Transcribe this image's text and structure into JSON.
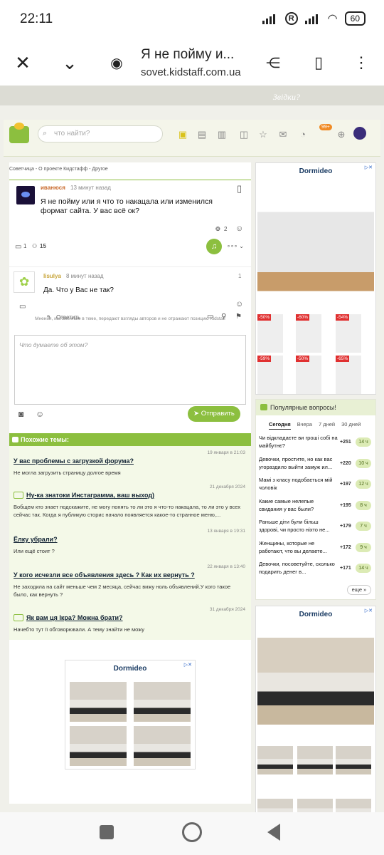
{
  "status": {
    "time": "22:11",
    "battery": "60"
  },
  "browser": {
    "title": "Я не пойму и...",
    "url": "sovet.kidstaff.com.ua"
  },
  "site": {
    "banner_text": "Звідки?",
    "search_placeholder": "что найти?",
    "badge": "99+"
  },
  "breadcrumb": "Советчица - О проекте Кидстафф - Другое",
  "post": {
    "author": "иванюся",
    "time": "13 минут назад",
    "text": "Я не пойму или я что то накацала или изменился формат сайта. У вас всё ок?",
    "reactions": "2",
    "comments": "1",
    "participants": "15"
  },
  "reply": {
    "author": "lisulya",
    "time": "8 минут назад",
    "number": "1",
    "text": "Да. Что у Вас не так?",
    "reply_label": "Ответить"
  },
  "disclaimer": "Мнения, изложенные в теме, передают взгляды авторов и не отражают позицию Kidstaff",
  "composer": {
    "placeholder": "Что думаете об этом?",
    "send_label": "Отправить"
  },
  "similar": {
    "title": "Похожие темы:",
    "topics": [
      {
        "title": "У вас проблемы с загрузкой форума?",
        "date": "19 января в 21:03",
        "text": "Не могла загрузить страницу долгое время",
        "icon": false
      },
      {
        "title": "Ну-ка знатоки Инстаграмма, ваш выход)",
        "date": "21 декабря 2024",
        "text": "Вобщем кто знает подскажите, не могу понять то ли это я что-то накацала, то ли это у всех сейчас так. Когда я публикую сторис начало появляется какое-то странное меню,...",
        "icon": true
      },
      {
        "title": "Ёлку убрали?",
        "date": "13 января в 19:31",
        "text": "Или ещё стоит ?",
        "icon": false
      },
      {
        "title": "У кого исчезли все объявления здесь ? Как их вернуть ?",
        "date": "22 января в 13:40",
        "text": "Не заходила на сайт меньше чем 2 месяца, сейчас вижу ноль объявлений.У кого такое было, как вернуть ?",
        "icon": false
      },
      {
        "title": "Як вам ця Ікра? Можна брати?",
        "date": "31 декабря 2024",
        "text": "Начебто тут її обговорювали. А тему знайти не можу",
        "icon": true
      }
    ]
  },
  "ads": {
    "brand": "Dormideo",
    "discounts": [
      "-50%",
      "-60%",
      "-54%",
      "-59%",
      "-50%",
      "-65%"
    ]
  },
  "popular": {
    "title": "Популярные вопросы!",
    "tabs": [
      "Сегодня",
      "Вчера",
      "7 дней",
      "30 дней"
    ],
    "more": "еще",
    "items": [
      {
        "text": "Чи відкладаєте ви гроші собі на майбутнє?",
        "n": "+251",
        "b": "14 ч"
      },
      {
        "text": "Девочки, простите, но как вас угораздило выйти замуж ил...",
        "n": "+220",
        "b": "10 ч"
      },
      {
        "text": "Мамі з класу подобається мій чоловік",
        "n": "+197",
        "b": "12 ч"
      },
      {
        "text": "Какие самые нелепые свидания у вас были?",
        "n": "+195",
        "b": "8 ч"
      },
      {
        "text": "Раньше діти були більш здорові, чи просто ніхто не...",
        "n": "+179",
        "b": "7 ч"
      },
      {
        "text": "Женщины, которые не работают, что вы делаете...",
        "n": "+172",
        "b": "9 ч"
      },
      {
        "text": "Девочки, посоветуйте, сколько подарить денег в...",
        "n": "+171",
        "b": "14 ч"
      }
    ]
  }
}
